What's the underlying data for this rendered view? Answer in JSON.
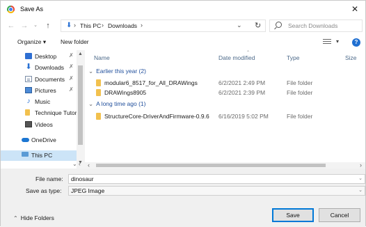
{
  "window": {
    "title": "Save As",
    "close_glyph": "✕"
  },
  "address": {
    "breadcrumbs": [
      "This PC",
      "Downloads"
    ],
    "search_placeholder": "Search Downloads"
  },
  "toolbar": {
    "organize_label": "Organize ▾",
    "new_folder_label": "New folder",
    "help_glyph": "?"
  },
  "nav": {
    "items": [
      {
        "label": "Desktop",
        "icon": "desktop-icon",
        "pinned": true
      },
      {
        "label": "Downloads",
        "icon": "download-arrow-icon",
        "pinned": true
      },
      {
        "label": "Documents",
        "icon": "documents-icon",
        "pinned": true
      },
      {
        "label": "Pictures",
        "icon": "pictures-icon",
        "pinned": true
      },
      {
        "label": "Music",
        "icon": "music-note-icon",
        "pinned": false
      },
      {
        "label": "Technique Tutori",
        "icon": "folder-icon",
        "pinned": false
      },
      {
        "label": "Videos",
        "icon": "videos-icon",
        "pinned": false
      },
      {
        "label": "OneDrive",
        "icon": "cloud-icon",
        "pinned": false
      },
      {
        "label": "This PC",
        "icon": "computer-icon",
        "pinned": false,
        "selected": true
      }
    ]
  },
  "list": {
    "columns": {
      "name": "Name",
      "date": "Date modified",
      "type": "Type",
      "size": "Size"
    },
    "groups": [
      {
        "label": "Earlier this year (2)",
        "rows": [
          {
            "name": "modular6_8517_for_All_DRAWings",
            "date": "6/2/2021 2:49 PM",
            "type": "File folder"
          },
          {
            "name": "DRAWings8905",
            "date": "6/2/2021 2:39 PM",
            "type": "File folder"
          }
        ]
      },
      {
        "label": "A long time ago (1)",
        "rows": [
          {
            "name": "StructureCore-DriverAndFirmware-0.9.6",
            "date": "6/16/2019 5:02 PM",
            "type": "File folder"
          }
        ]
      }
    ]
  },
  "form": {
    "file_name_label": "File name:",
    "file_name_value": "dinosaur",
    "save_type_label": "Save as type:",
    "save_type_value": "JPEG Image",
    "hide_folders_label": "Hide Folders",
    "save_label": "Save",
    "cancel_label": "Cancel"
  },
  "colors": {
    "accent": "#0078d7",
    "selection": "#cce4f7",
    "folder": "#f2c14e",
    "group_header": "#1f4e9b"
  }
}
